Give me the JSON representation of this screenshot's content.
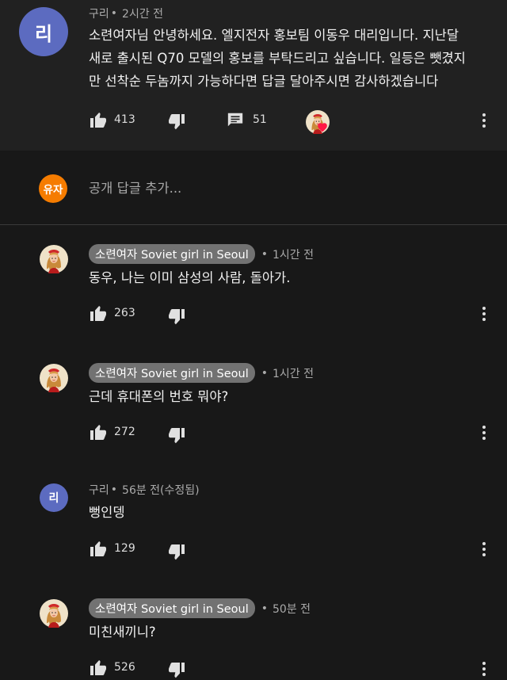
{
  "main_comment": {
    "avatar_letter": "리",
    "avatar_color": "#5c6bc0",
    "author": "구리",
    "time": "2시간 전",
    "text_lines": [
      "소련여자님 안녕하세요. 엘지전자 홍보팀 이동우 대리입니다. 지난달",
      "새로 출시된 Q70 모델의 홍보를 부탁드리고 싶습니다. 일등은 뺏겼지",
      "만 선착순 두놈까지 가능하다면 답글 달아주시면 감사하겠습니다"
    ],
    "likes": "413",
    "replies": "51"
  },
  "reply_input": {
    "avatar_letter": "유자",
    "avatar_color": "#f57c00",
    "placeholder": "공개 답글 추가..."
  },
  "replies": [
    {
      "author": "소련여자 Soviet girl in Seoul",
      "time": "1시간 전",
      "text": "동우, 나는 이미 삼성의 사람, 돌아가.",
      "likes": "263"
    },
    {
      "author": "소련여자 Soviet girl in Seoul",
      "time": "1시간 전",
      "text": "근데 휴대폰의 번호 뭐야?",
      "likes": "272"
    },
    {
      "author": "구리",
      "time": "56분 전(수정됨)",
      "text": "뻥인뎅",
      "likes": "129",
      "avatar_letter": "리"
    },
    {
      "author": "소련여자 Soviet girl in Seoul",
      "time": "50분 전",
      "text": "미친새끼니?",
      "likes": "526"
    }
  ],
  "icons": {
    "like": "thumb-up-icon",
    "dislike": "thumb-down-icon",
    "reply": "comment-icon",
    "more": "more-vert-icon",
    "creator_heart": "creator-heart-icon"
  }
}
